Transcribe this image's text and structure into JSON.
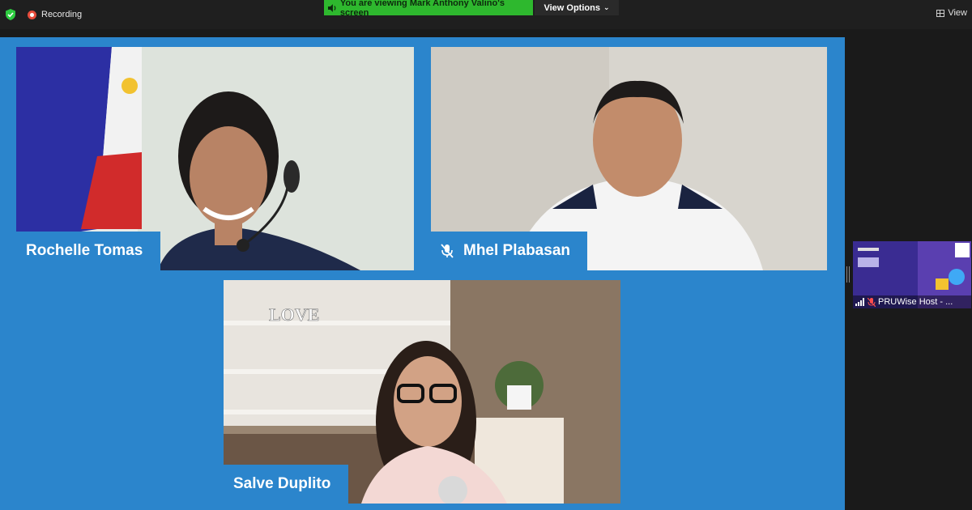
{
  "topbar": {
    "recording_label": "Recording",
    "viewing_banner": "You are viewing Mark Anthony Valino's screen",
    "view_options_label": "View Options",
    "view_label": "View"
  },
  "participants": [
    {
      "name": "Rochelle Tomas"
    },
    {
      "name": "Mhel Plabasan",
      "muted": true
    },
    {
      "name": "Salve Duplito"
    }
  ],
  "scene_text": {
    "love_sign": "LOVE"
  },
  "thumbnail": {
    "label": "PRUWise Host - ...",
    "muted": true
  },
  "colors": {
    "share_bg": "#2b85cc",
    "banner_green": "#2eb82e",
    "topbar_bg": "#1f1f1f"
  }
}
